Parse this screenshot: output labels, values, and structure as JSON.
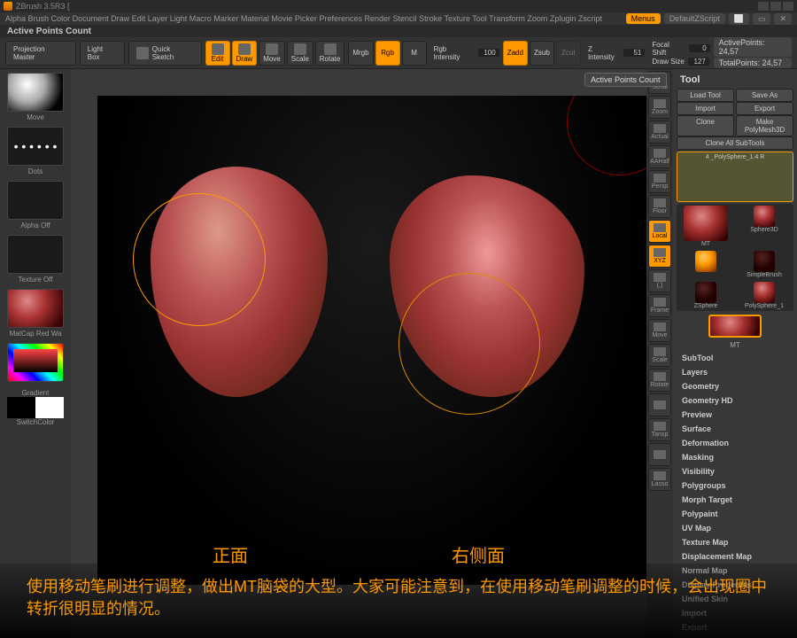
{
  "title": "ZBrush 3.5R3  [",
  "info_bar": "Active Points Count",
  "menu": [
    "Alpha",
    "Brush",
    "Color",
    "Document",
    "Draw",
    "Edit",
    "Layer",
    "Light",
    "Macro",
    "Marker",
    "Material",
    "Movie",
    "Picker",
    "Preferences",
    "Render",
    "Stencil",
    "Stroke",
    "Texture",
    "Tool",
    "Transform",
    "Zoom",
    "Zplugin",
    "Zscript"
  ],
  "menu_right": {
    "menus": "Menus",
    "script": "DefaultZScript"
  },
  "toolbar": {
    "projection": "Projection Master",
    "lightbox": "Light Box",
    "quicksketch": "Quick Sketch",
    "edit": "Edit",
    "draw": "Draw",
    "move": "Move",
    "scale": "Scale",
    "rotate": "Rotate",
    "mrgb": "Mrgb",
    "rgb": "Rgb",
    "m": "M",
    "rgb_intensity_label": "Rgb Intensity",
    "rgb_intensity": "100",
    "zadd": "Zadd",
    "zsub": "Zsub",
    "zcut": "Zcut",
    "z_intensity_label": "Z Intensity",
    "z_intensity": "51",
    "focal_label": "Focal Shift",
    "focal": "0",
    "drawsize_label": "Draw Size",
    "drawsize": "127",
    "active_pts": "ActivePoints: 24,57",
    "total_pts": "TotalPoints: 24,57"
  },
  "shelf": {
    "move": "Move",
    "dots": "Dots",
    "alpha": "Alpha Off",
    "texture": "Texture Off",
    "matcap": "MatCap Red Wa",
    "gradient": "Gradient",
    "switch": "SwitchColor"
  },
  "canvas": {
    "label_front": "正面",
    "label_side": "右侧面"
  },
  "dock": [
    "Scroll",
    "Zoom",
    "Actual",
    "AAHalf",
    "Persp",
    "Floor",
    "Local",
    "XYZ",
    "(,)",
    "Frame",
    "Move",
    "Scale",
    "Rotate",
    "",
    "Tansp",
    "",
    "Lasso"
  ],
  "dock_orange": [
    6,
    7
  ],
  "tool": {
    "title": "Tool",
    "buttons": [
      [
        "Load Tool",
        "Save As"
      ],
      [
        "Import",
        "Export"
      ],
      [
        "Clone",
        "Make PolyMesh3D"
      ],
      [
        "Clone All SubTools",
        ""
      ]
    ],
    "slider": "4 _PolySphere_1.4 R",
    "items": [
      [
        "MT",
        "Sphere3D"
      ],
      [
        "",
        "SimpleBrush"
      ],
      [
        "ZSphere",
        "PolySphere_1"
      ]
    ],
    "selected": "MT",
    "sections": [
      "SubTool",
      "Layers",
      "Geometry",
      "Geometry HD",
      "Preview",
      "Surface",
      "Deformation",
      "Masking",
      "Visibility",
      "Polygroups",
      "Morph Target",
      "Polypaint",
      "UV Map",
      "Texture Map",
      "Displacement Map",
      "Normal Map",
      "Display Properties",
      "Unified Skin",
      "Import",
      "Export"
    ]
  },
  "tooltip": "Active Points Count",
  "caption": "使用移动笔刷进行调整，做出MT脑袋的大型。大家可能注意到，在使用移动笔刷调整的时候，会出现圈中转折很明显的情况。"
}
